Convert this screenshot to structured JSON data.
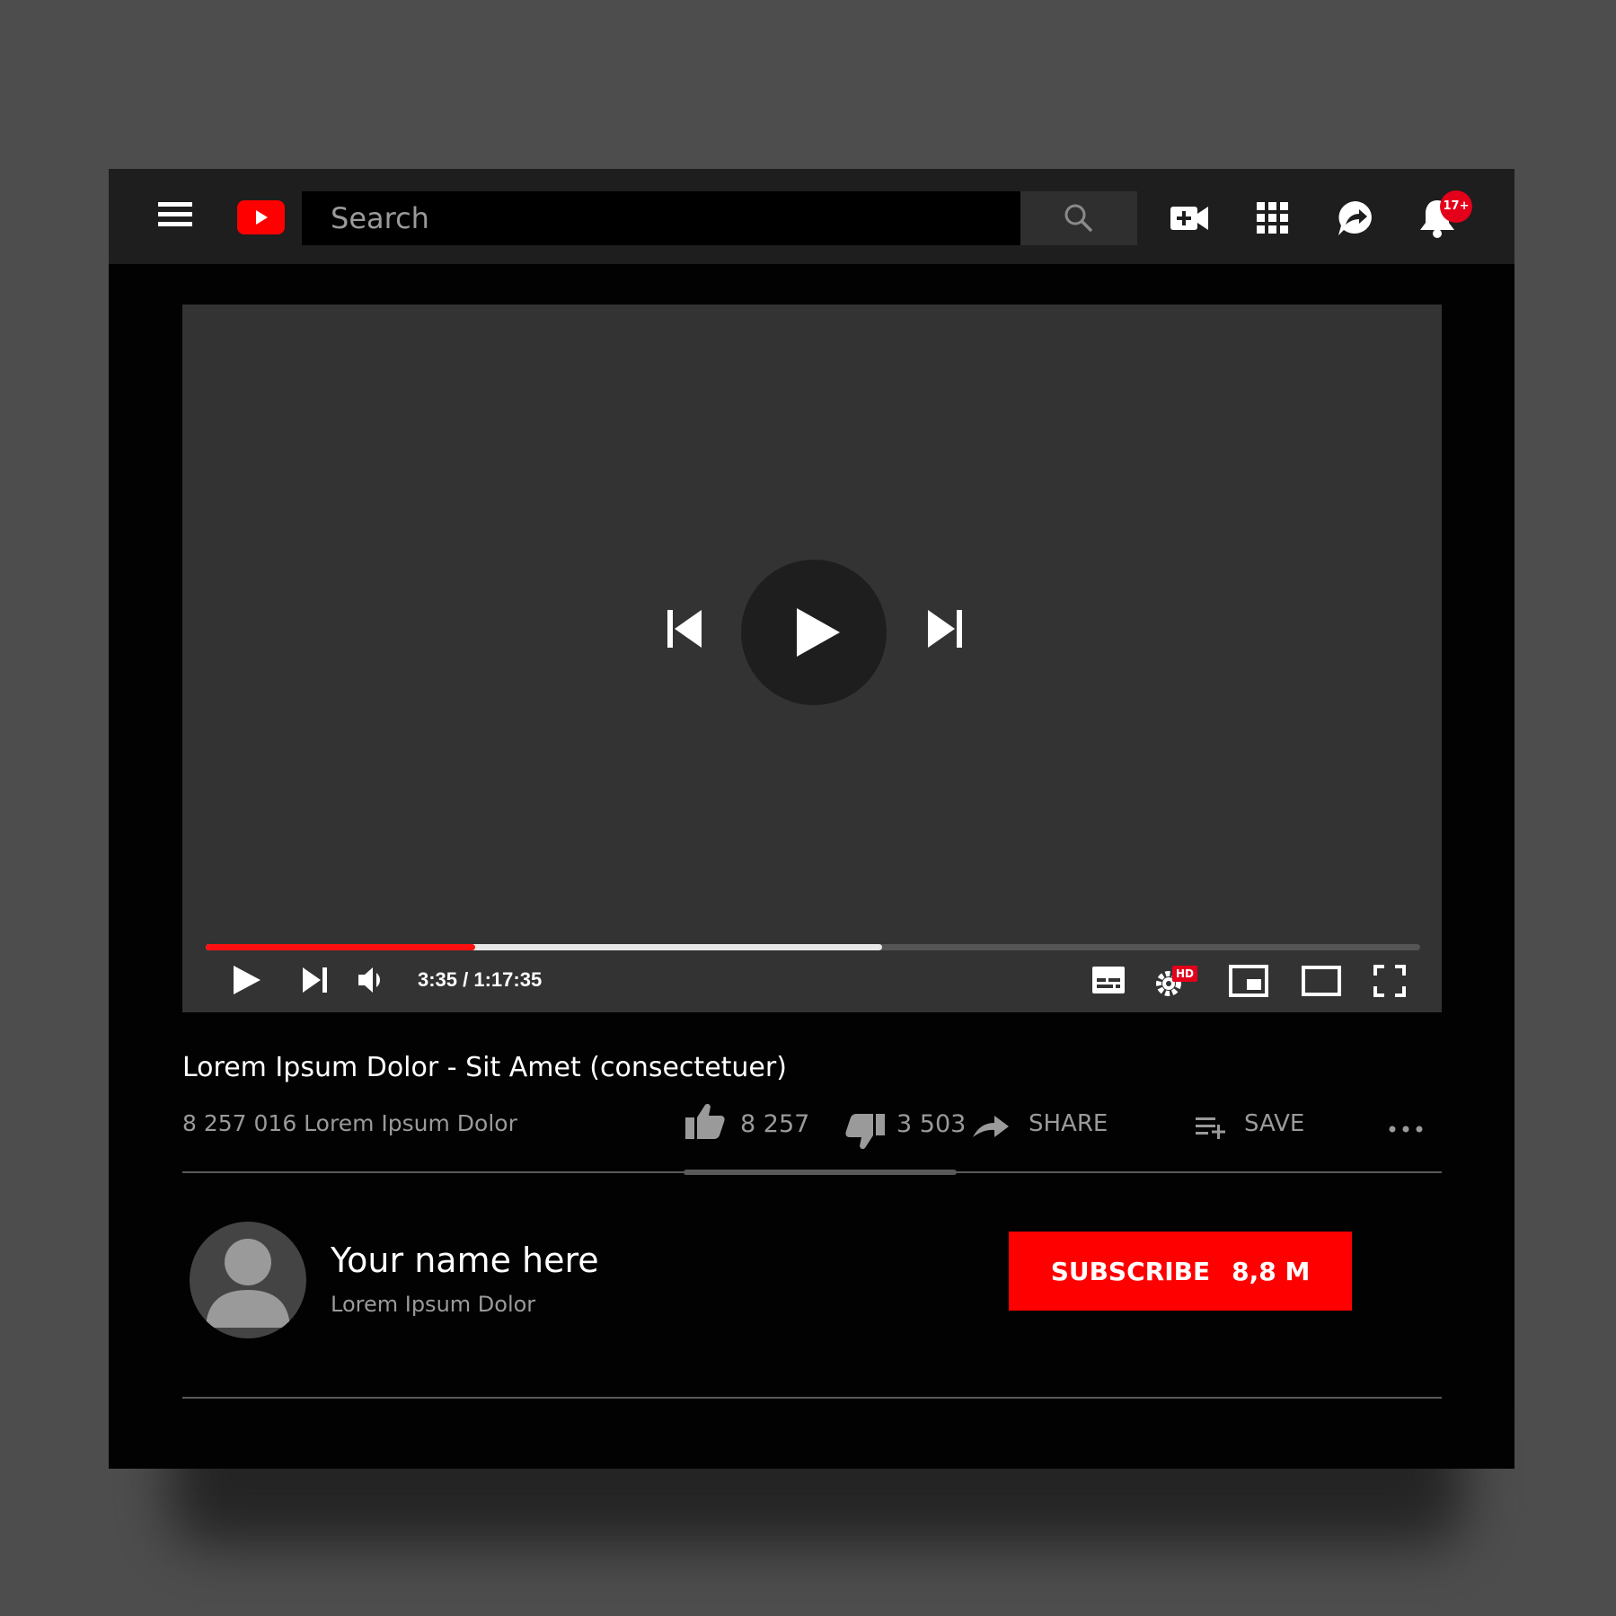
{
  "header": {
    "search_placeholder": "Search",
    "notification_count": "17+"
  },
  "player": {
    "time": "3:35 / 1:17:35",
    "played_fraction": 0.222,
    "buffered_fraction": 0.557,
    "hd_label": "HD"
  },
  "video": {
    "title": "Lorem Ipsum Dolor - Sit Amet (consectetuer)",
    "views": "8 257 016 Lorem Ipsum Dolor",
    "likes": "8 257",
    "dislikes": "3 503",
    "share_label": "SHARE",
    "save_label": "SAVE"
  },
  "channel": {
    "name": "Your name here",
    "subtitle": "Lorem Ipsum Dolor",
    "subscribe_label": "SUBSCRIBE",
    "subscriber_count": "8,8 M"
  },
  "colors": {
    "brand_red": "#ff0000",
    "background": "#020202",
    "player_bg": "#333333"
  }
}
